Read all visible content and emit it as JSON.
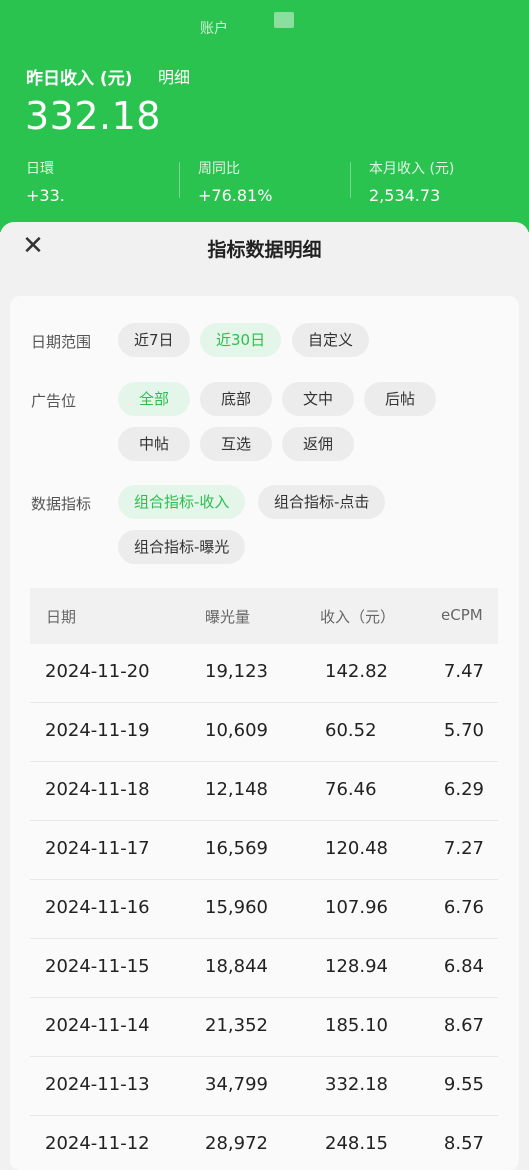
{
  "header": {
    "account_label": "账户",
    "income_label": "昨日收入 (元)",
    "detail_link": "明细",
    "income_value": "332.18",
    "stats": [
      {
        "label": "日環",
        "value": "+33."
      },
      {
        "label": "周同比",
        "value": "+76.81%"
      },
      {
        "label": "本月收入 (元)",
        "value": "2,534.73"
      }
    ]
  },
  "sheet": {
    "title": "指标数据明细",
    "close_glyph": "✕"
  },
  "filters": {
    "date_range": {
      "label": "日期范围",
      "options": [
        "近7日",
        "近30日",
        "自定义"
      ],
      "selected": "近30日"
    },
    "ad_slot": {
      "label": "广告位",
      "options": [
        "全部",
        "底部",
        "文中",
        "后帖",
        "中帖",
        "互选",
        "返佣"
      ],
      "selected": "全部"
    },
    "metric": {
      "label": "数据指标",
      "options": [
        "组合指标-收入",
        "组合指标-点击",
        "组合指标-曝光"
      ],
      "selected": "组合指标-收入"
    }
  },
  "table": {
    "columns": [
      "日期",
      "曝光量",
      "收入（元）",
      "eCPM"
    ],
    "rows": [
      [
        "2024-11-20",
        "19,123",
        "142.82",
        "7.47"
      ],
      [
        "2024-11-19",
        "10,609",
        "60.52",
        "5.70"
      ],
      [
        "2024-11-18",
        "12,148",
        "76.46",
        "6.29"
      ],
      [
        "2024-11-17",
        "16,569",
        "120.48",
        "7.27"
      ],
      [
        "2024-11-16",
        "15,960",
        "107.96",
        "6.76"
      ],
      [
        "2024-11-15",
        "18,844",
        "128.94",
        "6.84"
      ],
      [
        "2024-11-14",
        "21,352",
        "185.10",
        "8.67"
      ],
      [
        "2024-11-13",
        "34,799",
        "332.18",
        "9.55"
      ],
      [
        "2024-11-12",
        "28,972",
        "248.15",
        "8.57"
      ]
    ]
  },
  "colors": {
    "brand_green": "#2bc34f",
    "chip_active_bg": "#e4f6ea",
    "chip_active_text": "#2bbf4d"
  }
}
